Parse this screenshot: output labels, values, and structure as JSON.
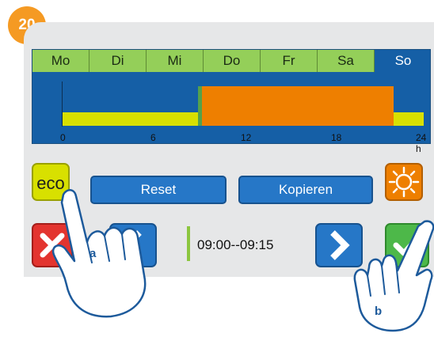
{
  "step": {
    "number": "20"
  },
  "days": [
    {
      "label": "Mo",
      "active": false
    },
    {
      "label": "Di",
      "active": false
    },
    {
      "label": "Mi",
      "active": false
    },
    {
      "label": "Do",
      "active": false
    },
    {
      "label": "Fr",
      "active": false
    },
    {
      "label": "Sa",
      "active": false
    },
    {
      "label": "So",
      "active": true
    }
  ],
  "timeline": {
    "ticks": [
      "0",
      "6",
      "12",
      "18",
      "24 h"
    ],
    "segments": [
      {
        "mode": "eco",
        "start": 0,
        "end": 9.0,
        "color": "#d8e000"
      },
      {
        "mode": "marker",
        "start": 9.0,
        "end": 9.25,
        "color": "#55a14c"
      },
      {
        "mode": "comfort",
        "start": 9.25,
        "end": 22.0,
        "color": "#ee7f00"
      },
      {
        "mode": "eco",
        "start": 22.0,
        "end": 24.0,
        "color": "#d8e000"
      }
    ]
  },
  "buttons": {
    "eco": "eco",
    "reset": "Reset",
    "copy": "Kopieren",
    "comfort_icon": "sun-icon",
    "cancel_icon": "close-icon",
    "prev_icon": "chevron-left-icon",
    "next_icon": "chevron-right-icon",
    "confirm_icon": "checkmark-icon"
  },
  "selected_time": "09:00--09:15",
  "hands": {
    "a": "a",
    "b": "b"
  },
  "colors": {
    "badge": "#f59a23",
    "screen_bg": "#155fa6",
    "day_tab": "#94cf59",
    "eco": "#d8e000",
    "comfort": "#ee7f00",
    "button_blue": "#2677c7",
    "cancel": "#e3342f",
    "confirm": "#4db849"
  }
}
